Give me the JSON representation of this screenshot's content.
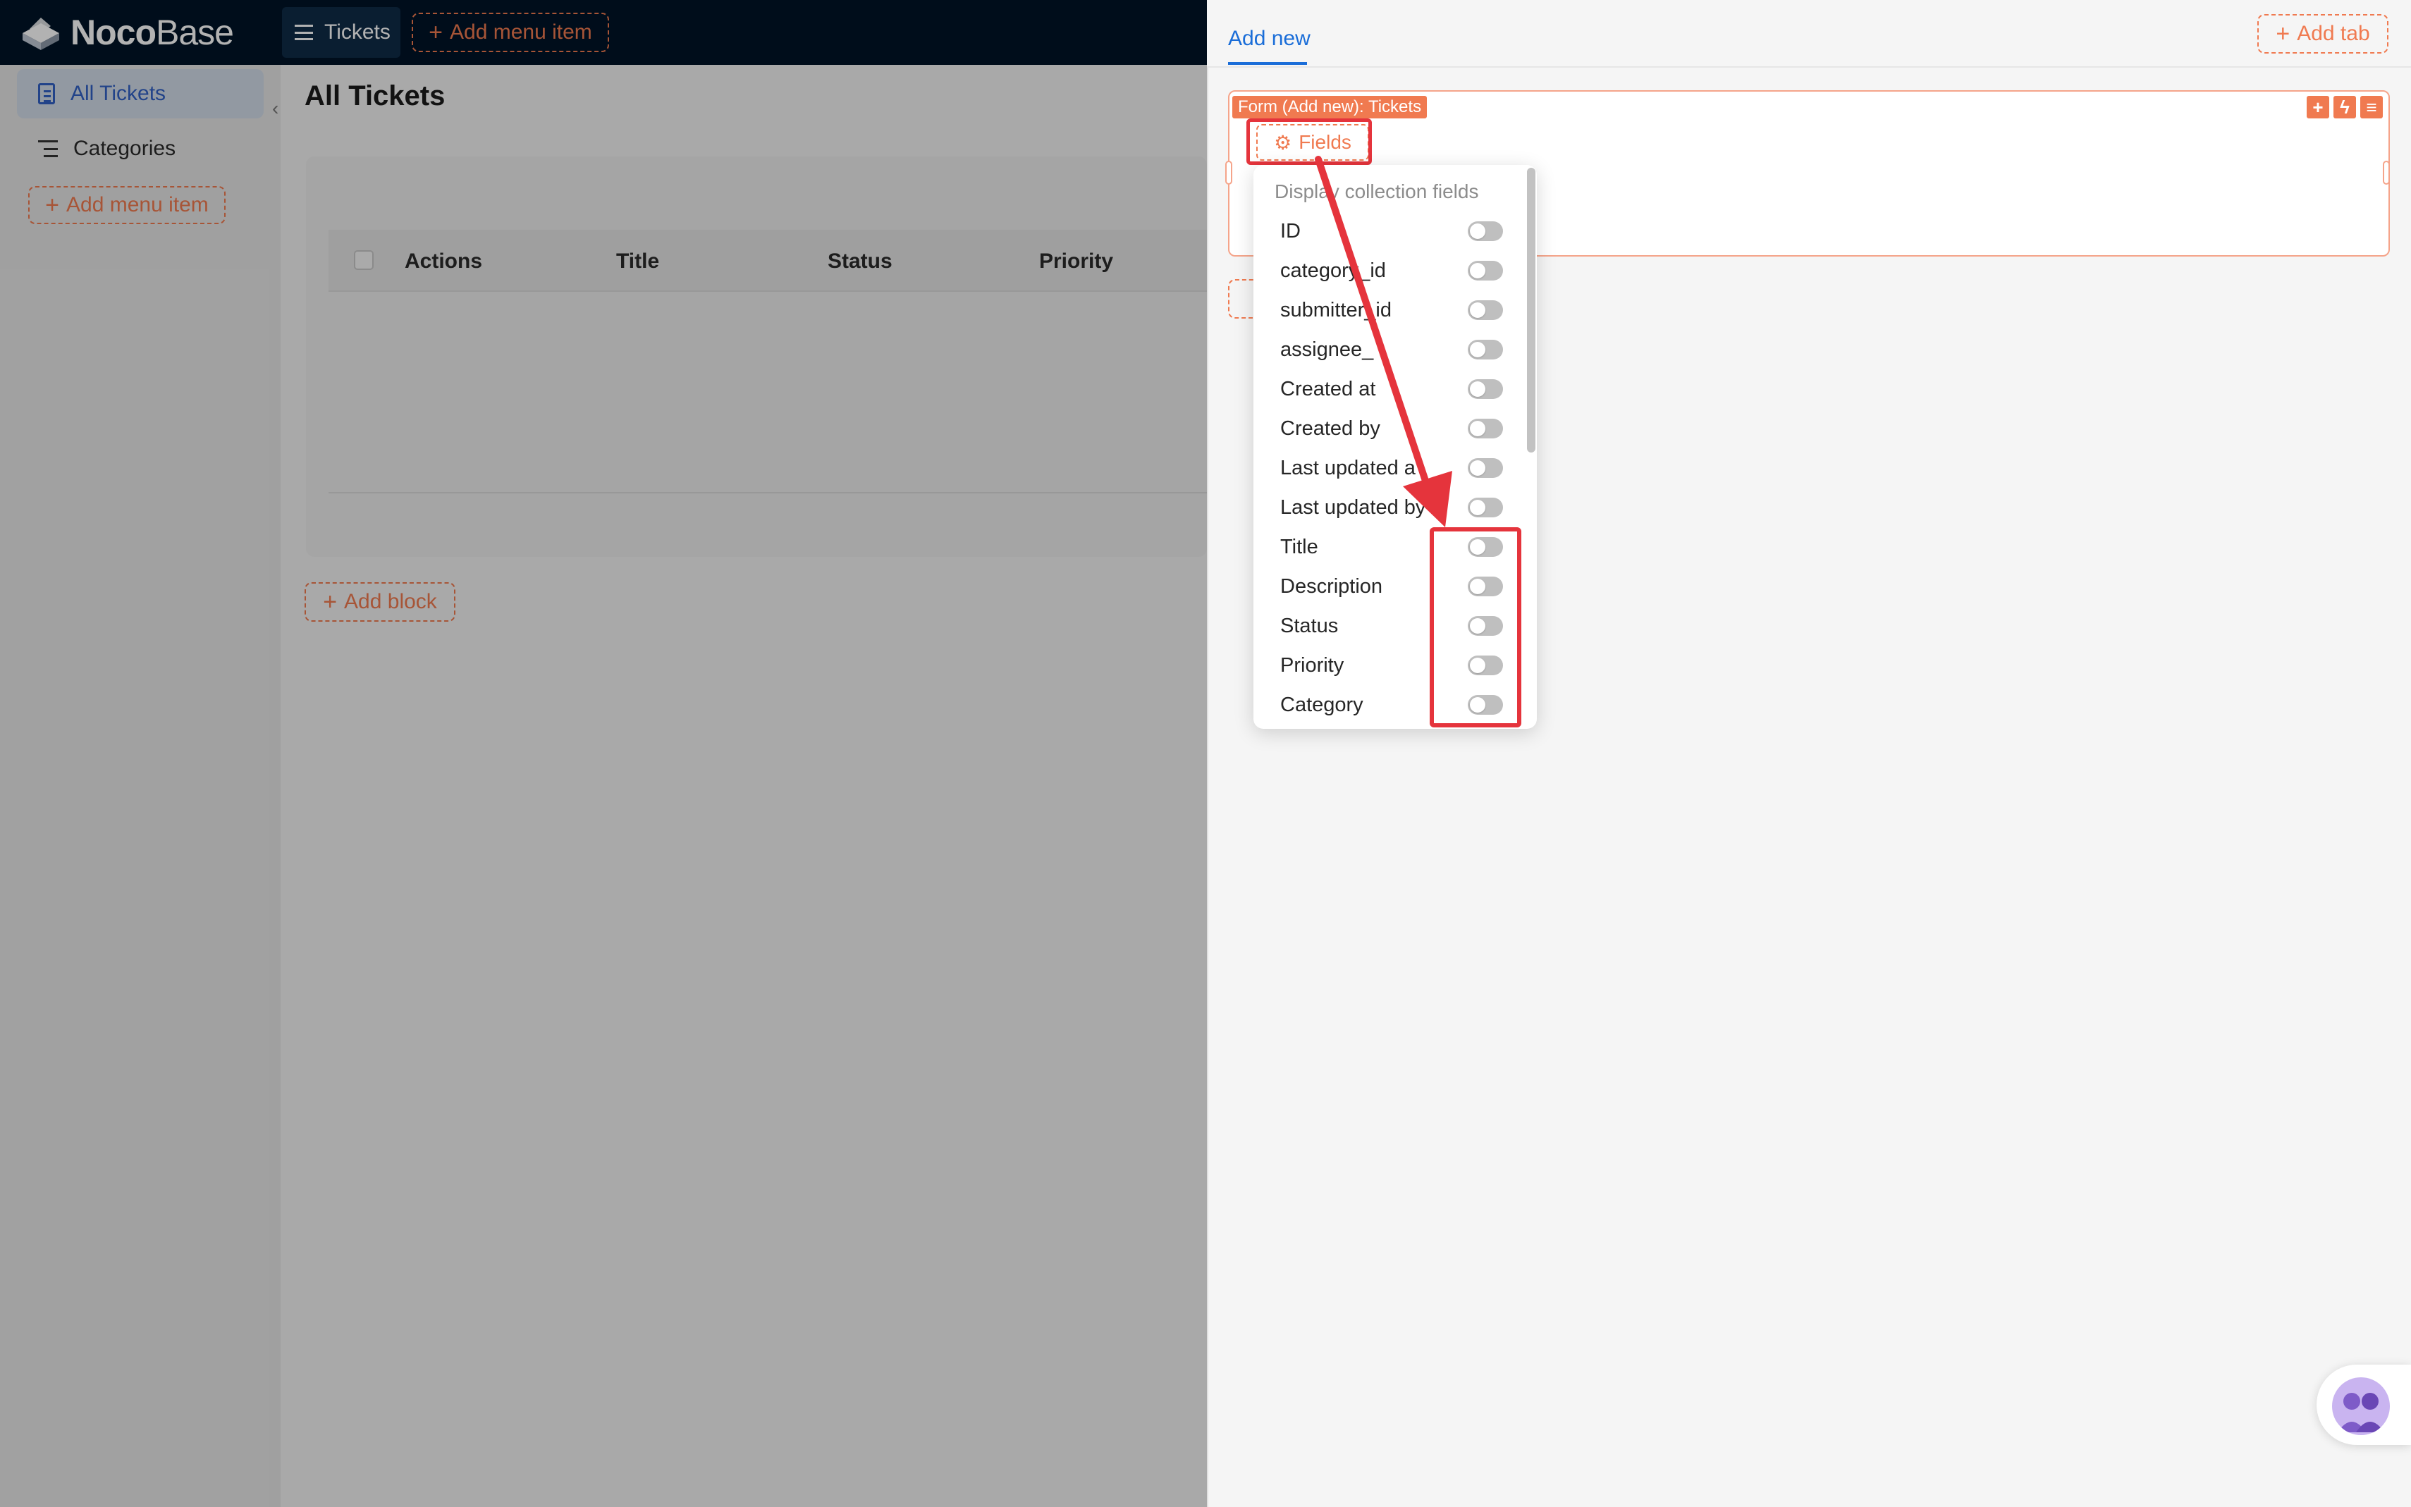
{
  "app": {
    "logo_bold": "Noco",
    "logo_regular": "Base",
    "top_menu": {
      "tickets": "Tickets",
      "add_menu_item": "Add menu item"
    }
  },
  "sidebar": {
    "items": [
      {
        "label": "All Tickets",
        "icon": "file-text-icon",
        "active": true
      },
      {
        "label": "Categories",
        "icon": "list-icon",
        "active": false
      }
    ],
    "add_menu_item": "Add menu item"
  },
  "main": {
    "title": "All Tickets",
    "columns": [
      "Actions",
      "Title",
      "Status",
      "Priority"
    ],
    "add_block": "Add block"
  },
  "drawer": {
    "tab": "Add new",
    "add_tab": "Add tab",
    "form_label": "Form (Add new): Tickets",
    "fields_button": "Fields",
    "dropdown": {
      "group_title": "Display collection fields",
      "fields": [
        {
          "label": "ID",
          "enabled": false
        },
        {
          "label": "category_id",
          "enabled": false
        },
        {
          "label": "submitter_id",
          "enabled": false
        },
        {
          "label": "assignee_",
          "enabled": false
        },
        {
          "label": "Created at",
          "enabled": false
        },
        {
          "label": "Created by",
          "enabled": false
        },
        {
          "label": "Last updated a",
          "enabled": false
        },
        {
          "label": "Last updated by",
          "enabled": false
        },
        {
          "label": "Title",
          "enabled": false
        },
        {
          "label": "Description",
          "enabled": false
        },
        {
          "label": "Status",
          "enabled": false
        },
        {
          "label": "Priority",
          "enabled": false
        },
        {
          "label": "Category",
          "enabled": false
        }
      ]
    }
  },
  "colors": {
    "header_bg": "#001428",
    "accent_orange": "#f07a50",
    "primary_blue": "#1a6dd8",
    "annotation_red": "#e5343c"
  }
}
